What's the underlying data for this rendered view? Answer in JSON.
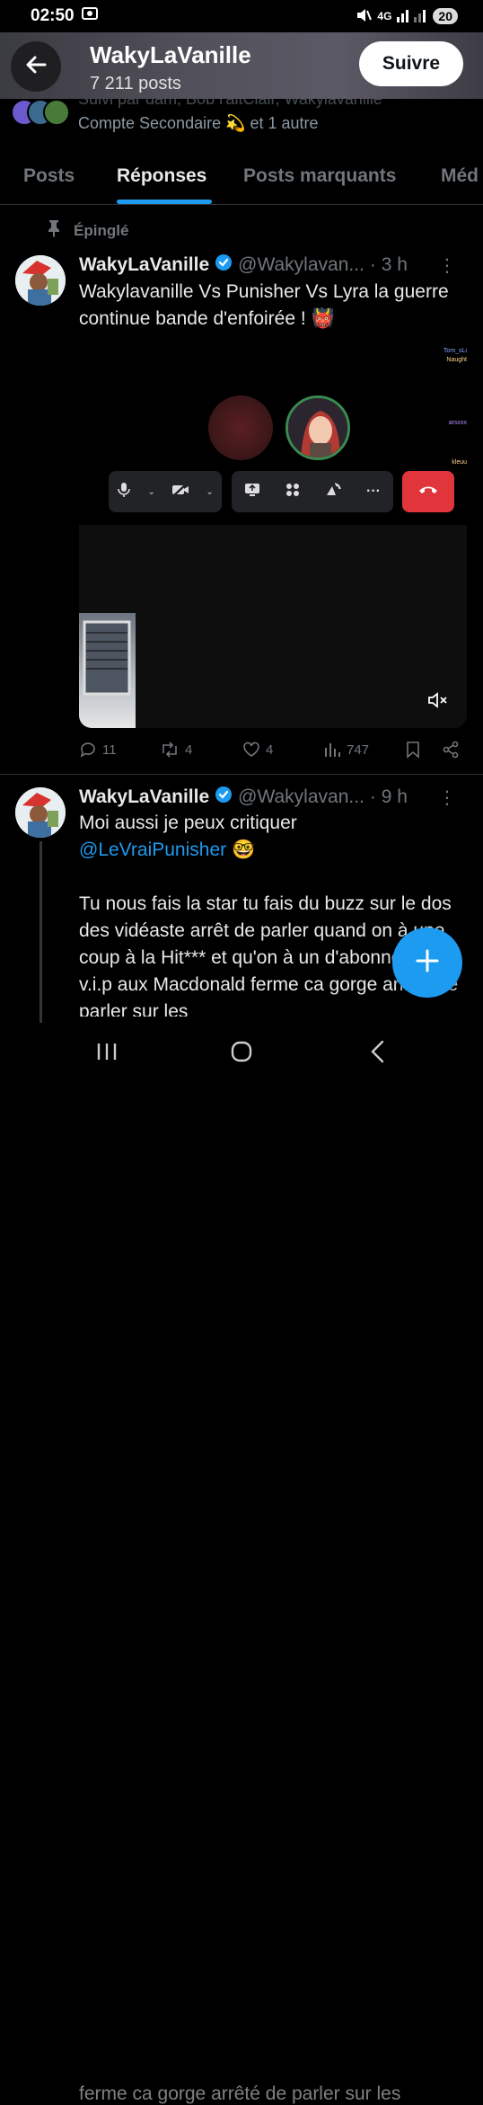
{
  "status": {
    "time": "02:50",
    "network": "4G",
    "battery": "20"
  },
  "header": {
    "name": "WakyLaVanille",
    "post_count": "7 211 posts",
    "follow_label": "Suivre"
  },
  "followed_by": {
    "line1": "Suivi par dam, Bob l'aitClair, Wakylavanille",
    "line2": "Compte Secondaire 💫 et 1 autre"
  },
  "tabs": [
    {
      "label": "Posts"
    },
    {
      "label": "Réponses"
    },
    {
      "label": "Posts marquants"
    },
    {
      "label": "Méd"
    }
  ],
  "pinned_label": "Épinglé",
  "posts": [
    {
      "name": "WakyLaVanille",
      "handle": "@Wakylavan...",
      "time": "· 3 h",
      "text": "Wakylavanille Vs Punisher Vs Lyra la guerre continue bande d'enfoirée ! 👹",
      "media_overlay": {
        "chat_1": "Tom_sLi",
        "chat_2": "Naught",
        "chat_3": "arsxxx",
        "chat_4": "kleuu"
      },
      "stats": {
        "replies": "11",
        "reposts": "4",
        "likes": "4",
        "views": "747"
      }
    },
    {
      "name": "WakyLaVanille",
      "handle": "@Wakylavan...",
      "time": "· 9 h",
      "text_line1": "Moi aussi je peux critiquer",
      "mention": "@LeVraiPunisher",
      "mention_emoji": "🤓",
      "text_body": "Tu nous fais la star tu fais du buzz sur le dos des vidéaste arrêt de parler quand on à une coup à la Hit*** et qu'on à un d'abonnement v.i.p aux Macdonald ferme ca gorge arrêté de parler sur les",
      "text_behind": "ferme ca gorge arrêté de parler sur les"
    }
  ],
  "colors": {
    "accent": "#1d9bf0",
    "hangup": "#e0353a",
    "muted": "#71767b"
  }
}
